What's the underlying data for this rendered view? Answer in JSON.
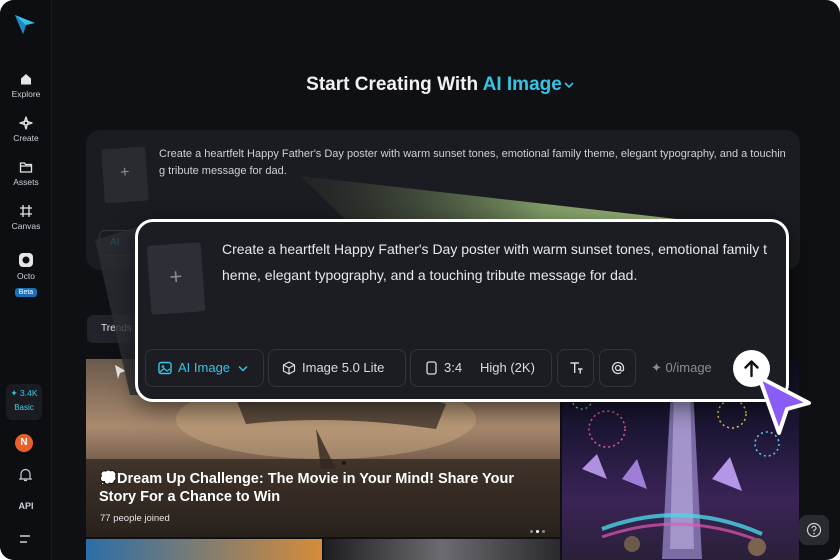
{
  "sidebar": {
    "items": [
      {
        "label": "Explore",
        "icon": "home-icon"
      },
      {
        "label": "Create",
        "icon": "sparkle-icon"
      },
      {
        "label": "Assets",
        "icon": "folder-icon"
      },
      {
        "label": "Canvas",
        "icon": "canvas-icon"
      },
      {
        "label": "Octo",
        "icon": "octo-icon",
        "badge": "Beta"
      }
    ],
    "credits_value": "3.4K",
    "credits_plan": "Basic",
    "avatar_initial": "N",
    "api_label": "API"
  },
  "header": {
    "title_prefix": "Start Creating With",
    "title_accent": "AI Image"
  },
  "background_card": {
    "prompt": "Create a heartfelt Happy Father's Day poster with warm sunset tones, emotional family theme, elegant typography, and a touching tribute message for dad.",
    "pill_label": "AI"
  },
  "tabs": {
    "trends_label": "Trends"
  },
  "gallery": {
    "challenge_title": "💭Dream Up Challenge: The Movie in Your Mind! Share Your Story For a Chance to Win",
    "joined_count": "77",
    "joined_text": "people joined"
  },
  "prompt_card": {
    "prompt": "Create a heartfelt Happy Father's Day poster with warm sunset tones, emotional family theme, elegant typography, and a touching tribute message for dad.",
    "mode_label": "AI Image",
    "model_label": "Image 5.0 Lite",
    "ratio_label": "3:4",
    "quality_label": "High (2K)",
    "cost_label": "0/image"
  },
  "colors": {
    "accent": "#35c4e3",
    "background": "#0f1013",
    "card": "#1c1d23",
    "cursor": "#8a5cf6"
  }
}
